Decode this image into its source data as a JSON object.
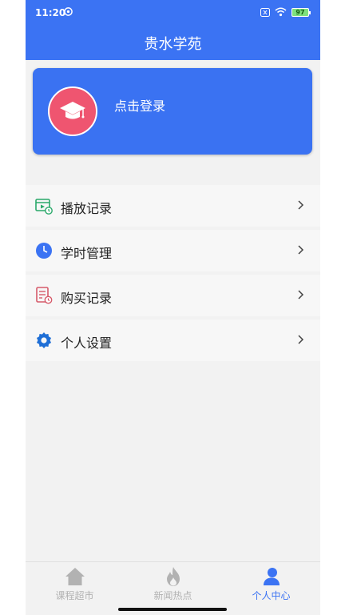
{
  "status_bar": {
    "time": "11:20",
    "battery": "97"
  },
  "app": {
    "title": "贵水学苑"
  },
  "login": {
    "label": "点击登录"
  },
  "menu": [
    {
      "label": "播放记录",
      "icon": "play-record-icon"
    },
    {
      "label": "学时管理",
      "icon": "clock-icon"
    },
    {
      "label": "购买记录",
      "icon": "purchase-record-icon"
    },
    {
      "label": "个人设置",
      "icon": "gear-icon"
    }
  ],
  "tabs": [
    {
      "label": "课程超市",
      "icon": "home-icon",
      "active": false
    },
    {
      "label": "新闻热点",
      "icon": "flame-icon",
      "active": false
    },
    {
      "label": "个人中心",
      "icon": "person-icon",
      "active": true
    }
  ],
  "colors": {
    "primary": "#3b73f3",
    "avatar_bg": "#ef5570",
    "inactive": "#b2b2b2"
  }
}
